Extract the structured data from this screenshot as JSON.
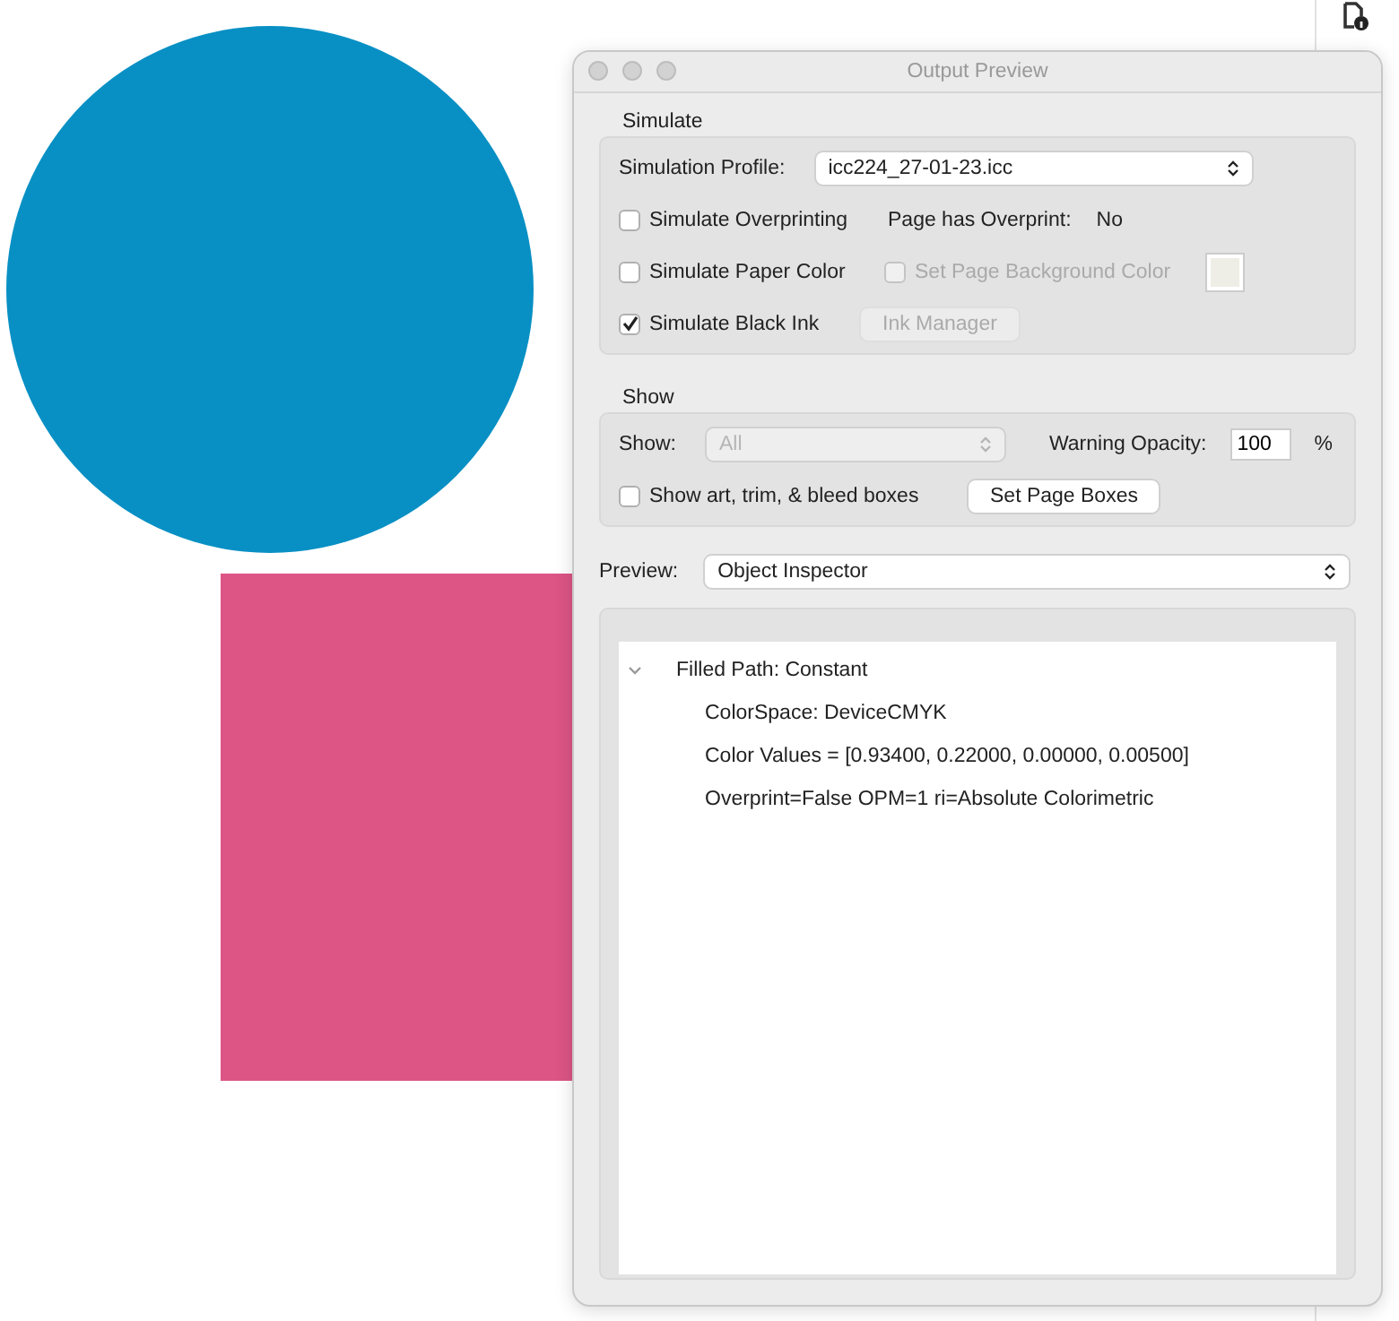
{
  "canvas": {
    "shapes": [
      {
        "kind": "circle"
      },
      {
        "kind": "square"
      }
    ]
  },
  "window": {
    "title": "Output Preview",
    "simulate": {
      "heading": "Simulate",
      "profile_label": "Simulation Profile:",
      "profile_value": "icc224_27-01-23.icc",
      "simulate_overprinting": {
        "label": "Simulate Overprinting",
        "checked": false
      },
      "overprint_label": "Page has Overprint:",
      "overprint_value": "No",
      "simulate_paper_color": {
        "label": "Simulate Paper Color",
        "checked": false
      },
      "set_page_background": {
        "label": "Set Page Background Color",
        "checked": false,
        "disabled": true
      },
      "simulate_black_ink": {
        "label": "Simulate Black Ink",
        "checked": true
      },
      "ink_manager": {
        "label": "Ink Manager",
        "disabled": true
      }
    },
    "show": {
      "heading": "Show",
      "show_label": "Show:",
      "show_value": "All",
      "show_disabled": true,
      "opacity_label": "Warning Opacity:",
      "opacity_value": "100",
      "percent": "%",
      "show_boxes": {
        "label": "Show art, trim, & bleed boxes",
        "checked": false
      },
      "set_page_boxes": "Set Page Boxes"
    },
    "preview_label": "Preview:",
    "preview_value": "Object Inspector",
    "inspector": [
      {
        "label": "Filled Path: Constant",
        "expanded": true,
        "children": [
          {
            "label": "ColorSpace: DeviceCMYK"
          },
          {
            "label": "Color Values = [0.93400, 0.22000, 0.00000, 0.00500]"
          },
          {
            "label": "Overprint=False OPM=1 ri=Absolute Colorimetric"
          }
        ]
      }
    ]
  }
}
